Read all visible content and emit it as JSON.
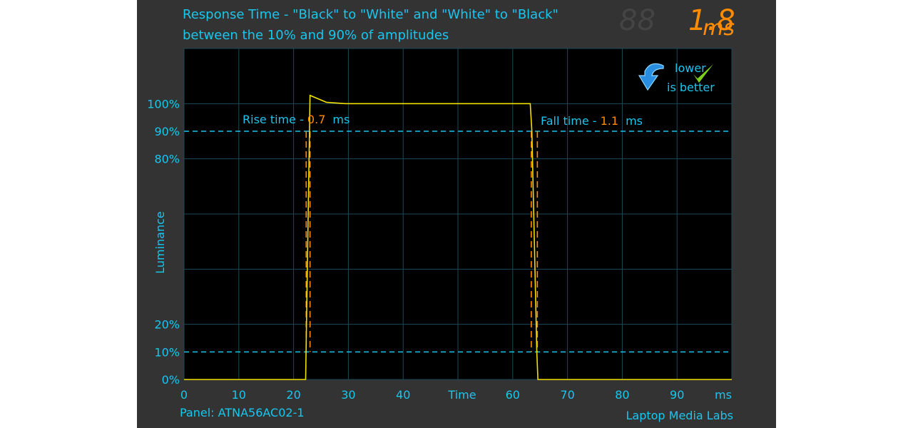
{
  "header": {
    "title_line1": "Response Time - \"Black\" to \"White\" and \"White\" to \"Black\"",
    "title_line2": "between the 10% and 90% of amplitudes",
    "readout_value": "1.8",
    "readout_unit": "ms",
    "badge_line1": "lower",
    "badge_line2": "is better"
  },
  "footer": {
    "panel": "Panel: ATNA56AC02-1",
    "brand": "Laptop Media Labs"
  },
  "colors": {
    "text": "#19c6ee",
    "accent": "#ff8c00",
    "signal": "#f0e000",
    "grid": "#1c4a5a",
    "background": "#000000",
    "panel": "#333333"
  },
  "chart_data": {
    "type": "line",
    "xlabel": "Time",
    "ylabel": "Luminance",
    "x_unit_label": "ms",
    "xlim": [
      0,
      100
    ],
    "ylim": [
      0,
      120
    ],
    "grid": true,
    "x_ticks": [
      "0",
      "10",
      "20",
      "30",
      "40",
      "60",
      "70",
      "80",
      "90"
    ],
    "y_ticks": [
      {
        "value": 0,
        "label": "0%"
      },
      {
        "value": 10,
        "label": "10%"
      },
      {
        "value": 20,
        "label": "20%"
      },
      {
        "value": 80,
        "label": "80%"
      },
      {
        "value": 90,
        "label": "90%"
      },
      {
        "value": 100,
        "label": "100%"
      }
    ],
    "threshold_lines": [
      10,
      90
    ],
    "series": [
      {
        "x": [
          0,
          22.2,
          23.0,
          26.0,
          29.5,
          63.2,
          63.5,
          64.4,
          64.6,
          100
        ],
        "y": [
          0,
          0,
          103,
          100.5,
          100,
          100,
          90,
          10,
          0,
          0
        ]
      }
    ],
    "annotations": {
      "rise": {
        "label": "Rise time - ",
        "value": "0.7",
        "unit": "ms",
        "markers": [
          22.3,
          23.0
        ]
      },
      "fall": {
        "label": "Fall time - ",
        "value": "1.1",
        "unit": "ms",
        "markers": [
          63.4,
          64.5
        ]
      }
    }
  }
}
